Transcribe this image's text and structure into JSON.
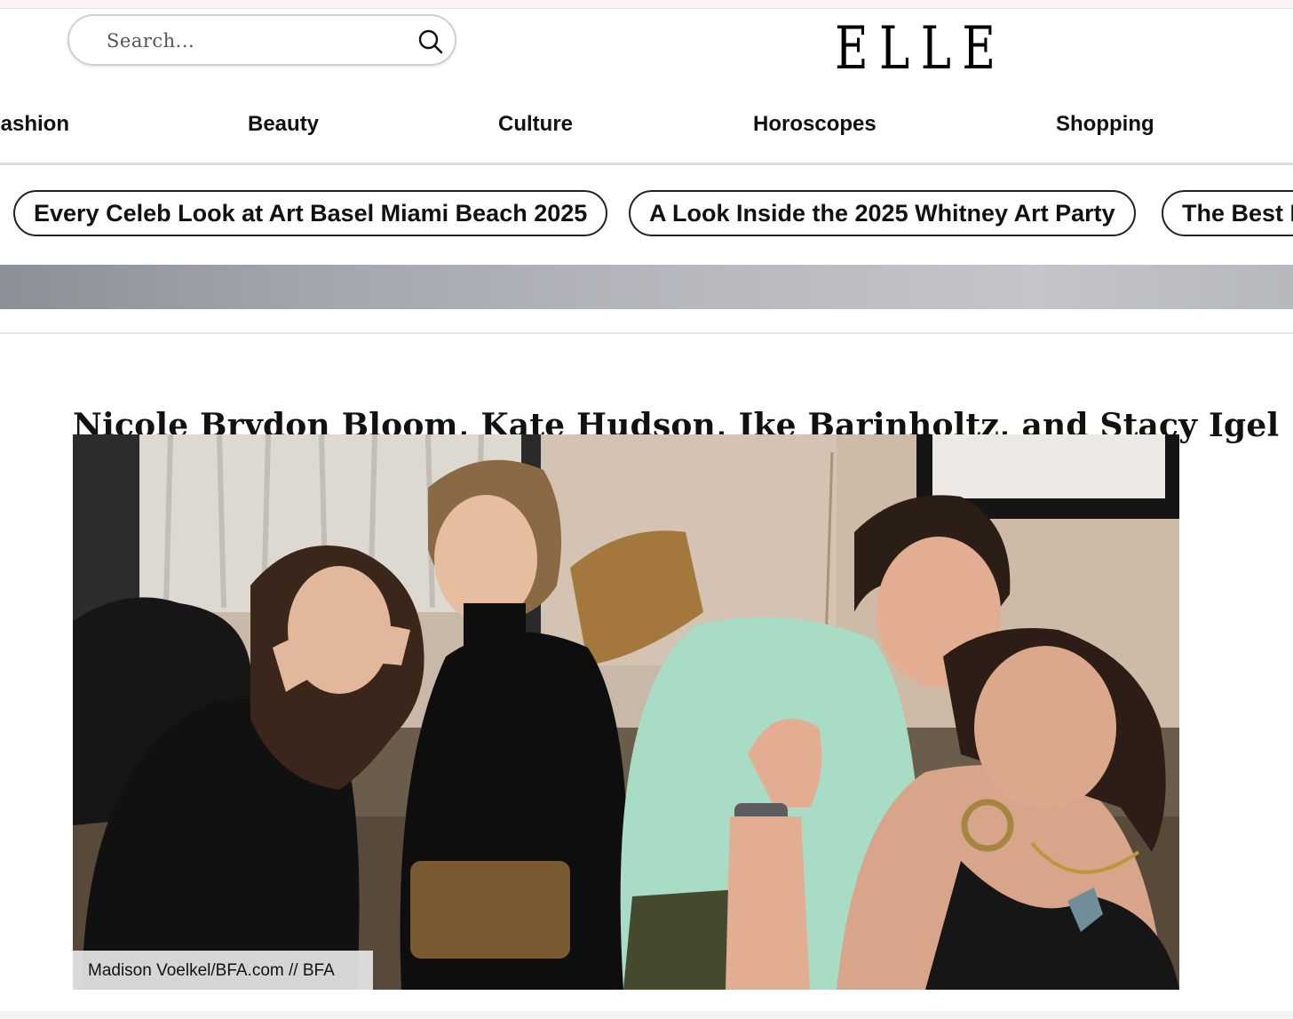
{
  "brand": {
    "logo_text": "ELLE"
  },
  "search": {
    "placeholder": "Search..."
  },
  "nav": {
    "items": [
      {
        "label": "Fashion"
      },
      {
        "label": "Beauty"
      },
      {
        "label": "Culture"
      },
      {
        "label": "Horoscopes"
      },
      {
        "label": "Shopping"
      }
    ]
  },
  "related_links": [
    {
      "label": "Every Celeb Look at Art Basel Miami Beach 2025"
    },
    {
      "label": "A Look Inside the 2025 Whitney Art Party"
    },
    {
      "label": "The Best Looks at Art Basel"
    }
  ],
  "article": {
    "image_caption": "Nicole Brydon Bloom, Kate Hudson, Ike Barinholtz, and Stacy Igel",
    "photo_credit": "Madison Voelkel/BFA.com  //  BFA"
  },
  "icons": {
    "search": "search-icon"
  },
  "colors": {
    "accent": "#000000",
    "pill_border": "#222222",
    "divider": "#d9d9d9"
  }
}
